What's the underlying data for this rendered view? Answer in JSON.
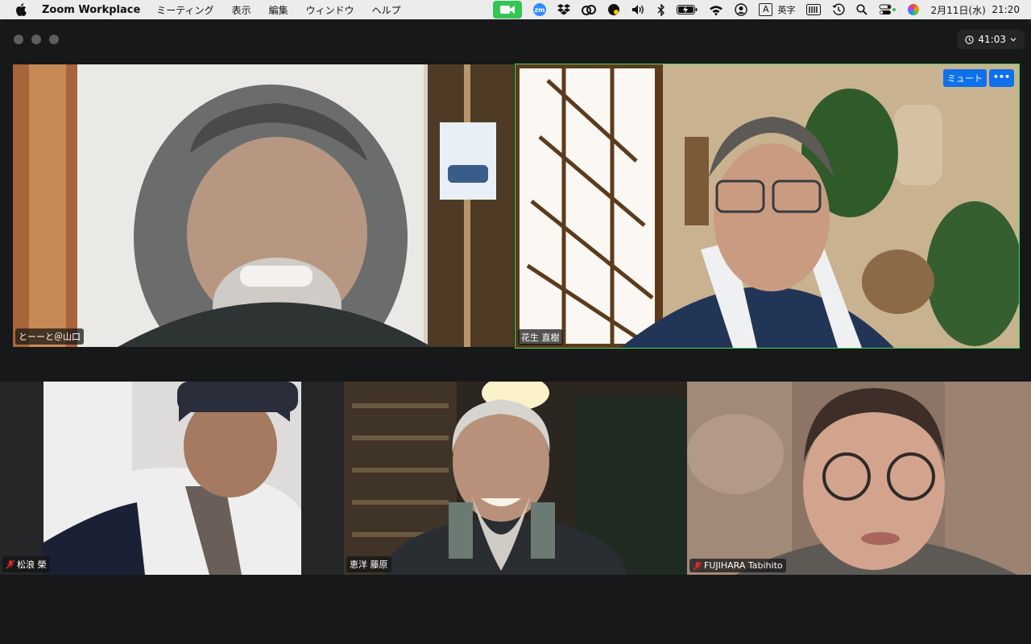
{
  "menubar": {
    "app_name": "Zoom Workplace",
    "menus": [
      "ミーティング",
      "表示",
      "編集",
      "ウィンドウ",
      "ヘルプ"
    ],
    "input_mode_badge": "A",
    "input_mode_label": "英字",
    "date": "2月11日(水)",
    "time": "21:20",
    "zoom_badge": "zm"
  },
  "meeting": {
    "timer": "41:03",
    "participants": [
      {
        "name": "とーーと＠山口",
        "muted": false,
        "active": false
      },
      {
        "name": "花生 直樹",
        "muted": false,
        "active": true
      },
      {
        "name": "松浪 榮",
        "muted": true,
        "active": false
      },
      {
        "name": "恵洋 藤原",
        "muted": false,
        "active": false
      },
      {
        "name": "FUJIHARA Tabihito",
        "muted": true,
        "active": false
      }
    ],
    "active_tile": {
      "mute_label": "ミュート",
      "more_label": "•••"
    }
  },
  "colors": {
    "active_border": "#3ddc5a",
    "button_blue": "#0e71eb",
    "muted_mic": "#e02828",
    "window_bg": "#161819"
  }
}
